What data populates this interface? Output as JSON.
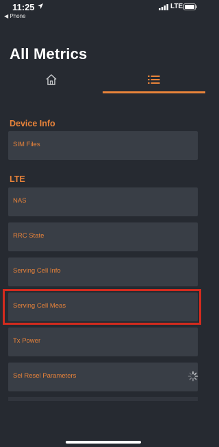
{
  "status_bar": {
    "time": "11:25",
    "back_label": "◀ Phone",
    "network": "LTE",
    "icons": [
      "location-arrow-icon",
      "signal-icon",
      "battery-icon"
    ]
  },
  "page_title": "All Metrics",
  "tabs": [
    {
      "name": "home",
      "icon": "home-icon",
      "selected": false
    },
    {
      "name": "list",
      "icon": "list-icon",
      "selected": true
    }
  ],
  "sections": {
    "device_info": {
      "title": "Device Info",
      "items": [
        "SIM Files"
      ]
    },
    "lte": {
      "title": "LTE",
      "items": [
        "NAS",
        "RRC State",
        "Serving Cell Info",
        "Serving Cell Meas",
        "Tx Power",
        "Sel Resel Parameters"
      ]
    }
  },
  "highlighted_item": "Serving Cell Meas",
  "colors": {
    "background": "#262a31",
    "card": "#393e46",
    "accent": "#e8833a",
    "highlight": "#d42b1e"
  }
}
